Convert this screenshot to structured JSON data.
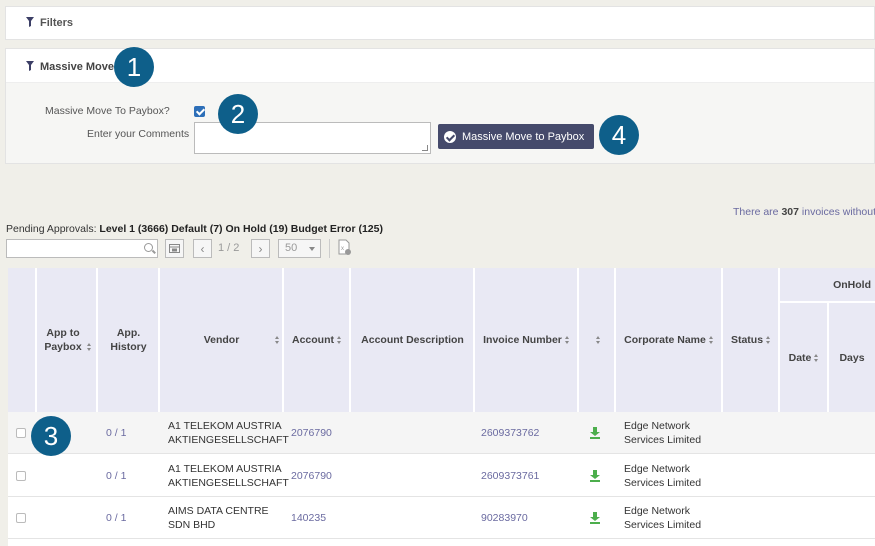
{
  "filters": {
    "title": "Filters"
  },
  "massive": {
    "title": "Massive Move",
    "paybox_label": "Massive Move To Paybox?",
    "paybox_checked": true,
    "comments_label": "Enter your Comments",
    "comments_value": "",
    "button_label": "Massive Move to Paybox"
  },
  "badges": [
    "1",
    "2",
    "3",
    "4"
  ],
  "pending": {
    "prefix": "Pending Approvals:",
    "text": "Level 1 (3666) Default (7) On Hold (19) Budget Error (125)"
  },
  "there": {
    "prefix": "There are",
    "count": "307",
    "suffix": "invoices without"
  },
  "toolbar": {
    "page_info": "1 / 2",
    "page_size": "50"
  },
  "columns": {
    "app_to_paybox": "App to Paybox",
    "app_history": "App. History",
    "vendor": "Vendor",
    "account": "Account",
    "account_desc": "Account Description",
    "invoice_number": "Invoice Number",
    "corporate_name": "Corporate Name",
    "status": "Status",
    "onhold": "OnHold",
    "date": "Date",
    "days": "Days"
  },
  "rows": [
    {
      "history": "0 / 1",
      "vendor": "A1 TELEKOM AUSTRIA AKTIENGESELLSCHAFT",
      "account": "2076790",
      "invoice": "2609373762",
      "corporate": "Edge Network Services Limited"
    },
    {
      "history": "0 / 1",
      "vendor": "A1 TELEKOM AUSTRIA AKTIENGESELLSCHAFT",
      "account": "2076790",
      "invoice": "2609373761",
      "corporate": "Edge Network Services Limited"
    },
    {
      "history": "0 / 1",
      "vendor": "AIMS DATA CENTRE SDN BHD",
      "account": "140235",
      "invoice": "90283970",
      "corporate": "Edge Network Services Limited"
    }
  ],
  "colors": {
    "accent": "#454a6b",
    "badge": "#0e5f8a",
    "link": "#6a6aa0",
    "download": "#4cae4c"
  },
  "icons": [
    "filter-icon",
    "check-circle-icon",
    "search-icon",
    "columns-icon",
    "chevron-left-icon",
    "chevron-right-icon",
    "excel-export-icon",
    "sort-icon",
    "download-icon"
  ]
}
